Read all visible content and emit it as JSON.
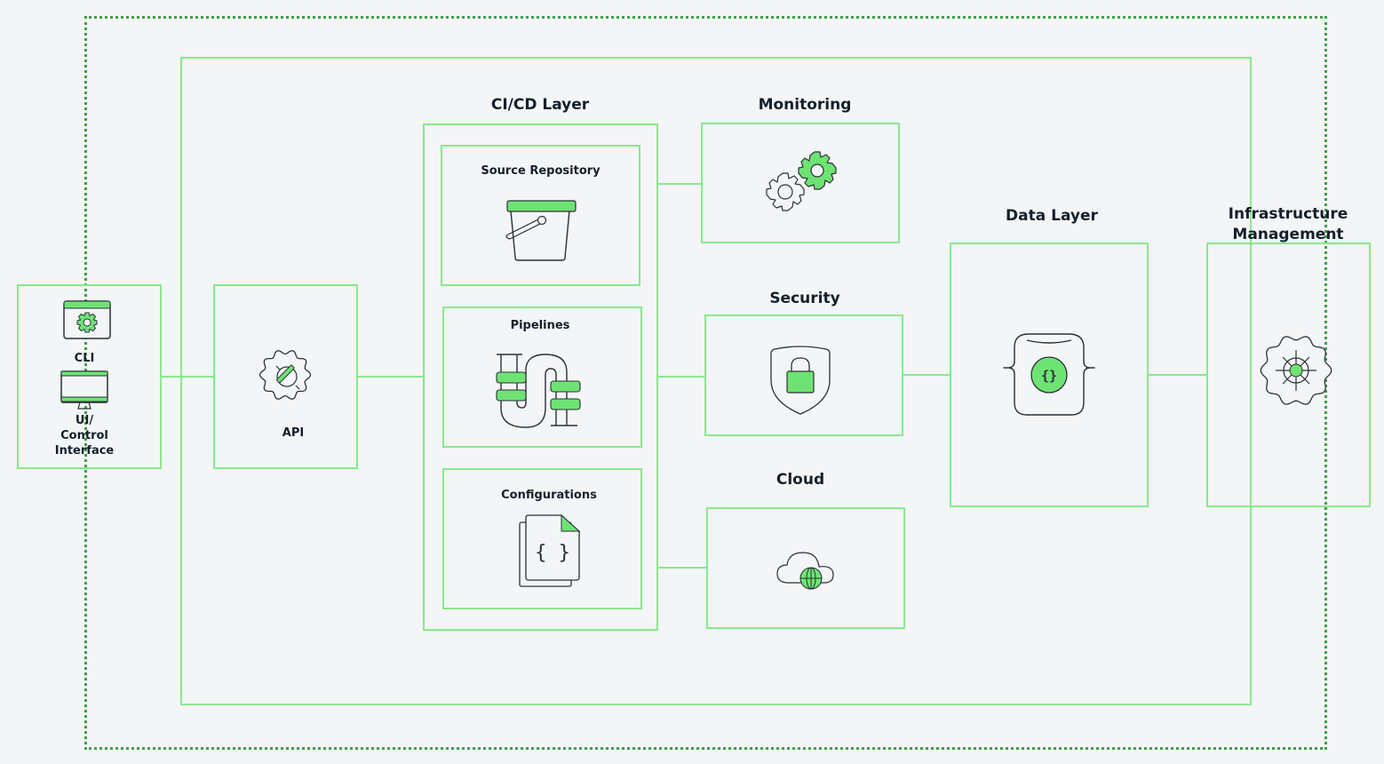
{
  "diagram": {
    "colors": {
      "accent": "#6ee374",
      "border": "#86ea8c",
      "dotted": "#3f9f4a",
      "ink": "#2a3038",
      "background": "#f4f5f7"
    },
    "client": {
      "cli_label": "CLI",
      "ui_label_line1": "UI/",
      "ui_label_line2": "Control",
      "ui_label_line3": "Interface",
      "cli_icon": "gear-window-icon",
      "ui_icon": "monitor-icon"
    },
    "api": {
      "label": "API",
      "icon": "api-gear-plug-icon"
    },
    "cicd": {
      "title": "CI/CD Layer",
      "items": [
        {
          "label": "Source Repository",
          "icon": "bucket-icon"
        },
        {
          "label": "Pipelines",
          "icon": "pipe-icon"
        },
        {
          "label": "Configurations",
          "icon": "config-file-icon"
        }
      ]
    },
    "services": [
      {
        "title": "Monitoring",
        "icon": "gears-icon"
      },
      {
        "title": "Security",
        "icon": "shield-lock-icon"
      },
      {
        "title": "Cloud",
        "icon": "cloud-globe-icon"
      }
    ],
    "data_layer": {
      "title": "Data Layer",
      "icon": "database-braces-icon"
    },
    "infrastructure": {
      "title_line1": "Infrastructure",
      "title_line2": "Management",
      "icon": "helm-gear-icon"
    }
  }
}
